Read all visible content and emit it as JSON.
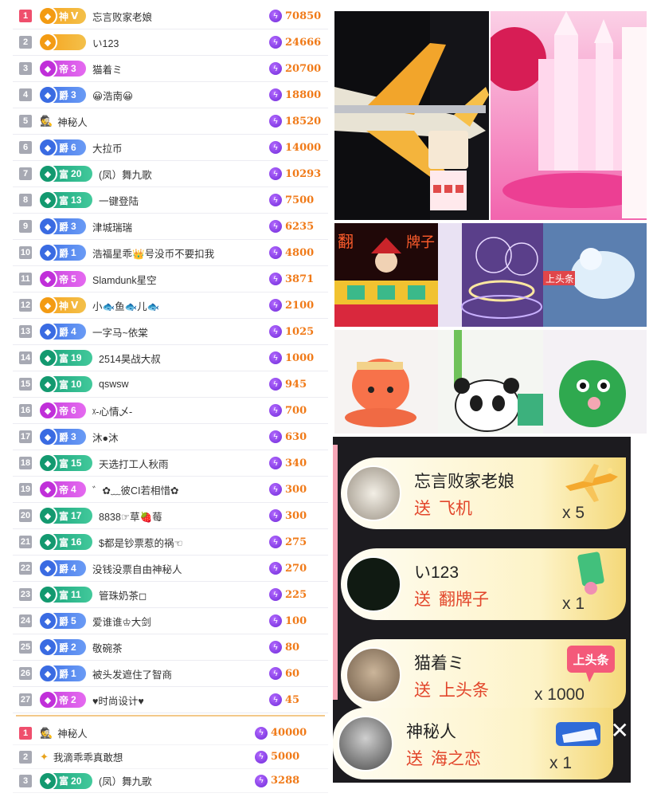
{
  "leaderboard": [
    {
      "rank": "1",
      "badge": "神",
      "level": "Ⅴ",
      "tier": "shen",
      "name": "忘言败家老娘",
      "score": "70850",
      "top": true
    },
    {
      "rank": "2",
      "badge": "",
      "level": "",
      "tier": "shen",
      "name": "い123",
      "score": "24666",
      "top": false
    },
    {
      "rank": "3",
      "badge": "帝",
      "level": "3",
      "tier": "di",
      "name": "猫着ミ",
      "score": "20700",
      "top": false
    },
    {
      "rank": "4",
      "badge": "爵",
      "level": "3",
      "tier": "jue",
      "name": "😀浩南😀",
      "score": "18800",
      "top": false
    },
    {
      "rank": "5",
      "badge": "",
      "level": "",
      "tier": "myst",
      "name": "神秘人",
      "score": "18520",
      "top": false
    },
    {
      "rank": "6",
      "badge": "爵",
      "level": "6",
      "tier": "jue",
      "name": "大拉币",
      "score": "14000",
      "top": false
    },
    {
      "rank": "7",
      "badge": "富",
      "level": "20",
      "tier": "fu",
      "name": "(凤）舞九歌",
      "score": "10293",
      "top": false
    },
    {
      "rank": "8",
      "badge": "富",
      "level": "13",
      "tier": "fu",
      "name": "一键登陆",
      "score": "7500",
      "top": false
    },
    {
      "rank": "9",
      "badge": "爵",
      "level": "3",
      "tier": "jue",
      "name": "津城瑞瑞",
      "score": "6235",
      "top": false
    },
    {
      "rank": "10",
      "badge": "爵",
      "level": "1",
      "tier": "jue",
      "name": "浩福星乖👑号没币不要扣我",
      "score": "4800",
      "top": false
    },
    {
      "rank": "11",
      "badge": "帝",
      "level": "5",
      "tier": "di",
      "name": "Slamdunk星空",
      "score": "3871",
      "top": false
    },
    {
      "rank": "12",
      "badge": "神",
      "level": "Ⅴ",
      "tier": "shen",
      "name": "小🐟鱼🐟儿🐟",
      "score": "2100",
      "top": false
    },
    {
      "rank": "13",
      "badge": "爵",
      "level": "4",
      "tier": "jue",
      "name": "一字马~依棠",
      "score": "1025",
      "top": false
    },
    {
      "rank": "14",
      "badge": "富",
      "level": "19",
      "tier": "fu",
      "name": "2514昊战大叔",
      "score": "1000",
      "top": false
    },
    {
      "rank": "15",
      "badge": "富",
      "level": "10",
      "tier": "fu",
      "name": "qswsw",
      "score": "945",
      "top": false
    },
    {
      "rank": "16",
      "badge": "帝",
      "level": "6",
      "tier": "di",
      "name": "ᵡ-心情乄-",
      "score": "700",
      "top": false
    },
    {
      "rank": "17",
      "badge": "爵",
      "level": "3",
      "tier": "jue",
      "name": "沐●沐",
      "score": "630",
      "top": false
    },
    {
      "rank": "18",
      "badge": "富",
      "level": "15",
      "tier": "fu",
      "name": "天选打工人秋雨",
      "score": "340",
      "top": false
    },
    {
      "rank": "19",
      "badge": "帝",
      "level": "4",
      "tier": "di",
      "name": "゛✿﹏彼CI若相惜✿",
      "score": "300",
      "top": false
    },
    {
      "rank": "20",
      "badge": "富",
      "level": "17",
      "tier": "fu",
      "name": "8838☞草🍓莓",
      "score": "300",
      "top": false
    },
    {
      "rank": "21",
      "badge": "富",
      "level": "16",
      "tier": "fu",
      "name": "$都是钞票惹的祸☜",
      "score": "275",
      "top": false
    },
    {
      "rank": "22",
      "badge": "爵",
      "level": "4",
      "tier": "jue",
      "name": "没钱没票自由神秘人",
      "score": "270",
      "top": false
    },
    {
      "rank": "23",
      "badge": "富",
      "level": "11",
      "tier": "fu",
      "name": "管珠奶茶◻",
      "score": "225",
      "top": false
    },
    {
      "rank": "24",
      "badge": "爵",
      "level": "5",
      "tier": "jue",
      "name": "爱谁谁♔大剑",
      "score": "100",
      "top": false
    },
    {
      "rank": "25",
      "badge": "爵",
      "level": "2",
      "tier": "jue",
      "name": "敬碗茶",
      "score": "80",
      "top": false
    },
    {
      "rank": "26",
      "badge": "爵",
      "level": "1",
      "tier": "jue",
      "name": "被头发遮住了智商",
      "score": "60",
      "top": false
    },
    {
      "rank": "27",
      "badge": "帝",
      "level": "2",
      "tier": "di",
      "name": "♥时尚设计♥",
      "score": "45",
      "top": false
    }
  ],
  "leaderboard2": [
    {
      "rank": "1",
      "badge": "",
      "level": "",
      "tier": "myst",
      "name": "神秘人",
      "score": "40000",
      "top": true
    },
    {
      "rank": "2",
      "badge": "",
      "level": "",
      "tier": "star",
      "name": "我滴乖乖真敢想",
      "score": "5000",
      "top": false
    },
    {
      "rank": "3",
      "badge": "富",
      "level": "20",
      "tier": "fu",
      "name": "(凤）舞九歌",
      "score": "3288",
      "top": false
    }
  ],
  "feed": [
    {
      "user": "忘言败家老娘",
      "gift_prefix": "送",
      "gift": "飞机",
      "qty": "x 5",
      "icon": "plane-icon"
    },
    {
      "user": "い123",
      "gift_prefix": "送",
      "gift": "翻牌子",
      "qty": "x 1",
      "icon": "card-flip-icon"
    },
    {
      "user": "猫着ミ",
      "gift_prefix": "送",
      "gift": "上头条",
      "qty": "x 1000",
      "icon": "headline-icon"
    },
    {
      "user": "神秘人",
      "gift_prefix": "送",
      "gift": "海之恋",
      "qty": "x 1",
      "icon": "yacht-icon"
    }
  ],
  "gift_tags": {
    "headline": "上头条"
  },
  "grid_texts": {
    "fanpaizi_left": "翻",
    "fanpaizi_right": "牌子",
    "live_label": "上头条"
  }
}
